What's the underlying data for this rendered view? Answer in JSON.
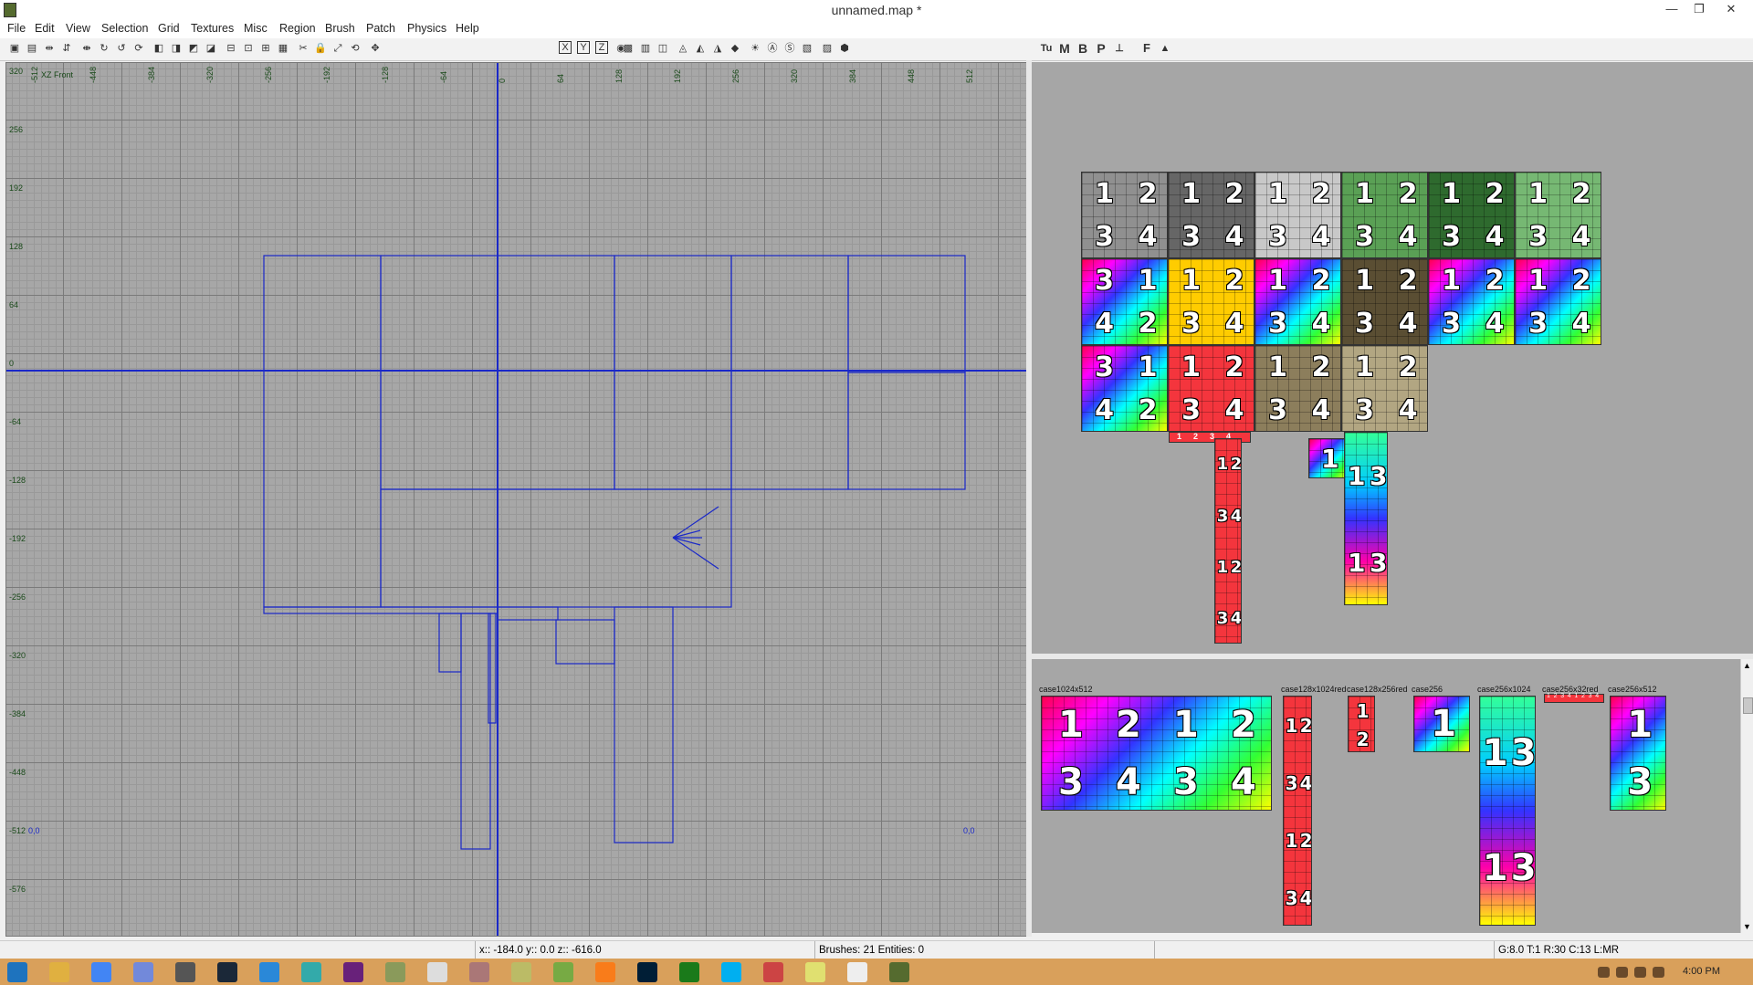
{
  "window": {
    "title": "unnamed.map *",
    "minimize": "—",
    "restore": "❐",
    "close": "✕"
  },
  "menu": [
    "File",
    "Edit",
    "View",
    "Selection",
    "Grid",
    "Textures",
    "Misc",
    "Region",
    "Brush",
    "Patch",
    "Physics",
    "Help"
  ],
  "toolbar": {
    "icons": [
      "open-icon",
      "save-icon",
      "flip-x-icon",
      "flip-y-icon",
      "flip-z-icon",
      "rotate-x-icon",
      "rotate-y-icon",
      "rotate-z-icon",
      "select-complete-tall-icon",
      "select-touching-icon",
      "select-partial-tall-icon",
      "select-inside-icon",
      "csg-subtract-icon",
      "csg-hollow-icon",
      "csg-merge-icon",
      "make-room-icon",
      "clipper-icon",
      "texture-lock-icon",
      "scale-icon",
      "rotate-icon",
      "drag-icon",
      "view-x-icon",
      "view-y-icon",
      "view-z-icon",
      "camera-icon",
      "cubic-clip-icon",
      "filter-icon",
      "patch-icon",
      "patch-bend-icon",
      "patch-insert-icon",
      "patch-inspect-icon",
      "entity-icon",
      "light-icon",
      "show-names-icon",
      "shader-icon",
      "region-icon",
      "monochrome-icon",
      "plugin-icon"
    ],
    "text_buttons": [
      "Tu",
      "M",
      "B",
      "P",
      "⊥",
      "F",
      "▲"
    ],
    "view_axis_labels": [
      "X",
      "Y",
      "Z"
    ]
  },
  "xz_view": {
    "label": "XZ Front",
    "x_ticks": [
      "-512",
      "-448",
      "-384",
      "-320",
      "-256",
      "-192",
      "-128",
      "-64",
      "0",
      "64",
      "128",
      "192",
      "256",
      "320",
      "384",
      "448",
      "512"
    ],
    "y_ticks": [
      "320",
      "256",
      "192",
      "128",
      "64",
      "0",
      "-64",
      "-128",
      "-192",
      "-256",
      "-320",
      "-384",
      "-448",
      "-512",
      "-576"
    ],
    "origin_labels": [
      "0,0",
      "0,0"
    ]
  },
  "camera_view": {
    "rows": [
      [
        {
          "n": [
            "1",
            "2",
            "3",
            "4"
          ],
          "c": "#909090"
        },
        {
          "n": [
            "1",
            "2",
            "3",
            "4"
          ],
          "c": "#666666"
        },
        {
          "n": [
            "1",
            "2",
            "3",
            "4"
          ],
          "c": "#c8c8c8"
        },
        {
          "n": [
            "1",
            "2",
            "3",
            "4"
          ],
          "c": "#5aa055"
        },
        {
          "n": [
            "1",
            "2",
            "3",
            "4"
          ],
          "c": "#2e6a2e"
        },
        {
          "n": [
            "1",
            "2",
            "3",
            "4"
          ],
          "c": "#76b873"
        }
      ],
      [
        {
          "n": [
            "3",
            "1",
            "4",
            "2"
          ],
          "c": "grad"
        },
        {
          "n": [
            "1",
            "2",
            "3",
            "4"
          ],
          "c": "#ffcc00"
        },
        {
          "n": [
            "1",
            "2",
            "3",
            "4"
          ],
          "c": "grad"
        },
        {
          "n": [
            "1",
            "2",
            "3",
            "4"
          ],
          "c": "#5a4e33"
        },
        {
          "n": [
            "1",
            "2",
            "3",
            "4"
          ],
          "c": "grad"
        },
        {
          "n": [
            "1",
            "2",
            "3",
            "4"
          ],
          "c": "grad"
        }
      ],
      [
        {
          "n": [
            "3",
            "1",
            "4",
            "2"
          ],
          "c": "grad"
        },
        {
          "n": [
            "1",
            "2",
            "3",
            "4"
          ],
          "c": "#f4353d"
        },
        {
          "n": [
            "1",
            "2",
            "3",
            "4"
          ],
          "c": "#8c7e5c"
        },
        {
          "n": [
            "1",
            "2",
            "3",
            "4"
          ],
          "c": "#b2a682"
        }
      ]
    ],
    "strip_small": [
      "1",
      "2",
      "3",
      "4"
    ],
    "strip_red_long": [
      "1",
      "2",
      "3",
      "4",
      "1",
      "2",
      "3",
      "4"
    ],
    "single_digit_tile": "1",
    "gradient_column": [
      "1",
      "3",
      "1",
      "3"
    ]
  },
  "texture_browser": {
    "labels": [
      "case1024x512",
      "case128x1024red",
      "case128x256red",
      "case256",
      "case256x1024",
      "case256x32red",
      "case256x512"
    ],
    "big_tile": [
      "1",
      "2",
      "1",
      "2",
      "3",
      "4",
      "3",
      "4"
    ],
    "red_column": [
      "1",
      "2",
      "3",
      "4",
      "1",
      "2",
      "3",
      "4"
    ],
    "red_short": [
      "1",
      "2"
    ],
    "case256_digit": "1",
    "case256x1024": [
      "1",
      "3",
      "1",
      "3"
    ],
    "red_strip": [
      "1",
      "2",
      "3",
      "4",
      "1",
      "2",
      "3",
      "4"
    ],
    "case256x512": [
      "1",
      "3"
    ]
  },
  "status": {
    "coords": "x:: -184.0  y:: 0.0  z:: -616.0",
    "counts": "Brushes: 21 Entities: 0",
    "grid": "G:8.0 T:1 R:30 C:13 L:MR"
  },
  "taskbar": {
    "icons": [
      "start-icon",
      "file-explorer-icon",
      "chrome-icon",
      "discord-icon",
      "game-icon",
      "steam-icon",
      "app-icon",
      "app-icon-2",
      "visual-studio-icon",
      "radiant-icon",
      "notepad-icon",
      "app-icon-3",
      "app-icon-4",
      "app-icon-5",
      "sublime-icon",
      "photoshop-icon",
      "vim-icon",
      "skype-icon",
      "headset-icon",
      "notes-icon",
      "doc-icon",
      "radiant-active-icon"
    ],
    "clock": "4:00 PM",
    "tray_icons": [
      "flag-icon",
      "mail-icon",
      "network-icon",
      "volume-icon"
    ]
  },
  "colors": {
    "brush_outline": "#1a28c8",
    "grid_bg": "#a7a7a7",
    "axis": "#1a28c8",
    "taskbar": "#d9a05b"
  }
}
